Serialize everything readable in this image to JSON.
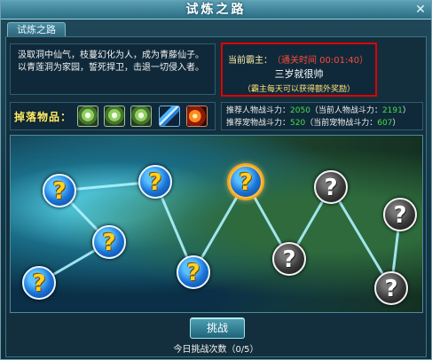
{
  "window": {
    "title": "试炼之路",
    "close_glyph": "✕",
    "tab_label": "试炼之路"
  },
  "description": "汲取洞中仙气，枝蔓幻化为人，成为青藤仙子。以青莲洞为家园，誓死捍卫，击退一切侵入者。",
  "king": {
    "label": "当前霸主：",
    "time": "（通关时间 00:01:40）",
    "name": "三岁就很帅",
    "note": "（霸主每天可以获得额外奖励）",
    "highlight_color": "#e10000"
  },
  "drops": {
    "label": "掉落物品：",
    "items": [
      {
        "icon": "green-gem-icon"
      },
      {
        "icon": "green-gem-icon"
      },
      {
        "icon": "green-gem-icon"
      },
      {
        "icon": "blue-crystal-icon"
      },
      {
        "icon": "fire-orb-icon"
      }
    ]
  },
  "power": {
    "player_label": "推荐人物战斗力：",
    "player_recommended": "2050",
    "player_current_prefix": "（当前人物战斗力：",
    "player_current": "2191",
    "player_current_suffix": "）",
    "pet_label": "推荐宠物战斗力：",
    "pet_recommended": "520",
    "pet_current_prefix": "（当前宠物战斗力：",
    "pet_current": "607",
    "pet_current_suffix": "）"
  },
  "stages": [
    {
      "state": "unlocked",
      "glyph": "?"
    },
    {
      "state": "unlocked",
      "glyph": "?"
    },
    {
      "state": "unlocked",
      "glyph": "?"
    },
    {
      "state": "unlocked",
      "glyph": "?"
    },
    {
      "state": "unlocked",
      "glyph": "?"
    },
    {
      "state": "current",
      "glyph": "?"
    },
    {
      "state": "locked",
      "glyph": "?"
    },
    {
      "state": "locked",
      "glyph": "?"
    },
    {
      "state": "locked",
      "glyph": "?"
    },
    {
      "state": "locked",
      "glyph": "?"
    }
  ],
  "challenge_button": "挑战",
  "attempts_label": "今日挑战次数（0/5）"
}
